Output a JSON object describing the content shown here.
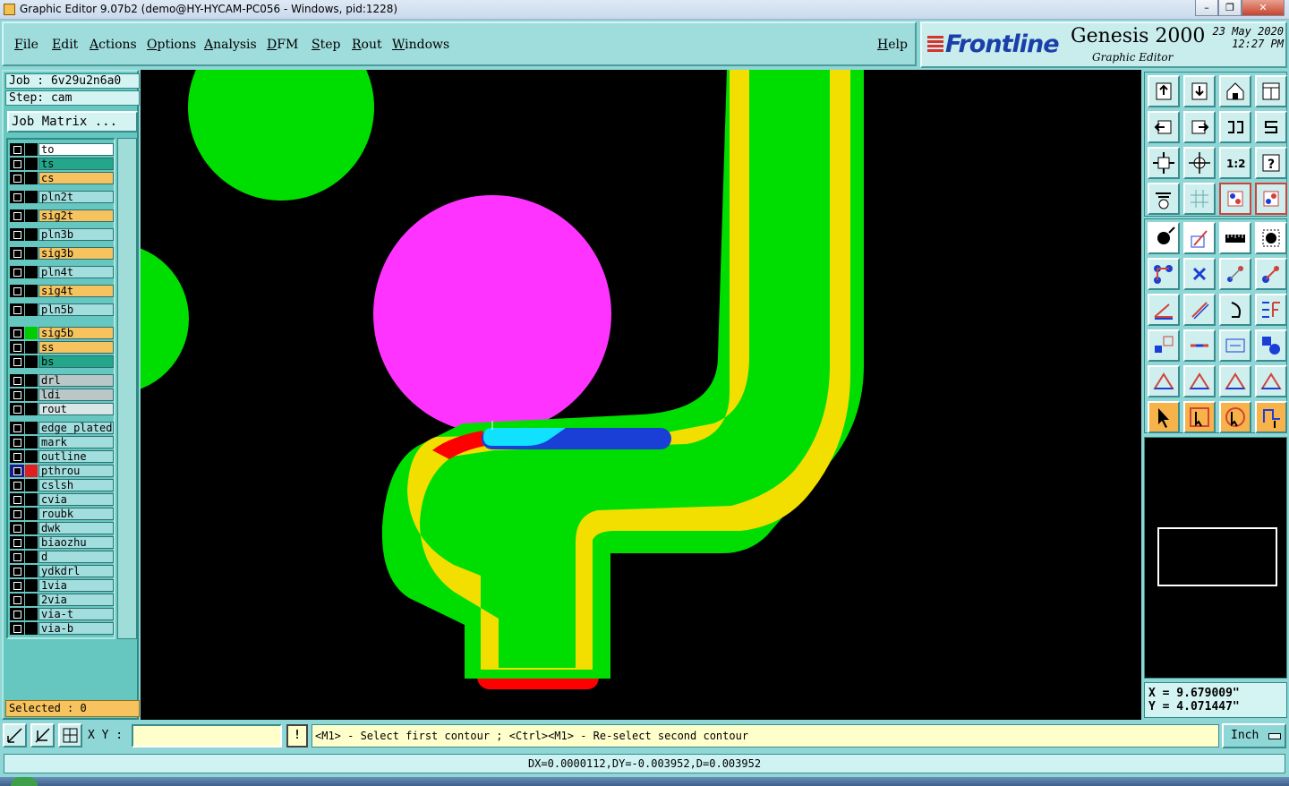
{
  "window": {
    "title": "Graphic Editor 9.07b2 (demo@HY-HYCAM-PC056 - Windows, pid:1228)",
    "controls": [
      "minimize",
      "restore",
      "close"
    ]
  },
  "menu": [
    "File",
    "Edit",
    "Actions",
    "Options",
    "Analysis",
    "DFM",
    "Step",
    "Rout",
    "Windows",
    "Help"
  ],
  "brand": {
    "logo": "Frontline",
    "product": "Genesis 2000",
    "subtitle": "Graphic Editor",
    "date": "23 May 2020",
    "time": "12:27 PM"
  },
  "job": {
    "label": "Job : 6v29u2n6a0",
    "step": "Step: cam",
    "matrix_button": "Job Matrix ..."
  },
  "layers": [
    {
      "name": "to",
      "color": "#ffffff",
      "swatch": ""
    },
    {
      "name": "ts",
      "color": "#23a68a",
      "swatch": "",
      "marker": "✎"
    },
    {
      "name": "cs",
      "color": "#f7c35f",
      "swatch": ""
    },
    {
      "name": "pln2t",
      "color": "#a3dede",
      "swatch": ""
    },
    {
      "name": "sig2t",
      "color": "#f7c35f",
      "swatch": ""
    },
    {
      "name": "pln3b",
      "color": "#a3dede",
      "swatch": ""
    },
    {
      "name": "sig3b",
      "color": "#f7c35f",
      "swatch": ""
    },
    {
      "name": "pln4t",
      "color": "#a3dede",
      "swatch": ""
    },
    {
      "name": "sig4t",
      "color": "#f7c35f",
      "swatch": ""
    },
    {
      "name": "pln5b",
      "color": "#a3dede",
      "swatch": ""
    },
    {
      "name": "sig5b",
      "color": "#f7c35f",
      "swatch": "#00cc00"
    },
    {
      "name": "ss",
      "color": "#f7c35f",
      "swatch": ""
    },
    {
      "name": "bs",
      "color": "#23a68a",
      "swatch": "",
      "marker": "✎"
    },
    {
      "name": "drl",
      "color": "#b9c7c7",
      "swatch": ""
    },
    {
      "name": "ldi",
      "color": "#b9c7c7",
      "swatch": ""
    },
    {
      "name": "rout",
      "color": "#d8e6e6",
      "swatch": ""
    },
    {
      "name": "edge_plated",
      "color": "#a3dede",
      "swatch": ""
    },
    {
      "name": "mark",
      "color": "#a3dede",
      "swatch": ""
    },
    {
      "name": "outline",
      "color": "#a3dede",
      "swatch": ""
    },
    {
      "name": "pthrou",
      "color": "#a3dede",
      "swatch": "#e02020",
      "marker": "▣",
      "affected": true
    },
    {
      "name": "cslsh",
      "color": "#a3dede",
      "swatch": ""
    },
    {
      "name": "cvia",
      "color": "#a3dede",
      "swatch": ""
    },
    {
      "name": "roubk",
      "color": "#a3dede",
      "swatch": ""
    },
    {
      "name": "dwk",
      "color": "#a3dede",
      "swatch": ""
    },
    {
      "name": "biaozhu",
      "color": "#a3dede",
      "swatch": ""
    },
    {
      "name": "d",
      "color": "#a3dede",
      "swatch": ""
    },
    {
      "name": "ydkdrl",
      "color": "#a3dede",
      "swatch": ""
    },
    {
      "name": "1via",
      "color": "#a3dede",
      "swatch": ""
    },
    {
      "name": "2via",
      "color": "#a3dede",
      "swatch": ""
    },
    {
      "name": "via-t",
      "color": "#a3dede",
      "swatch": ""
    },
    {
      "name": "via-b",
      "color": "#a3dede",
      "swatch": ""
    }
  ],
  "selected": "Selected : 0",
  "coords": {
    "x": "X = 9.679009\"",
    "y": "Y = 4.071447\""
  },
  "command": {
    "xy_label": "X Y :",
    "xy_value": "",
    "prompt": "<M1> - Select first contour ; <Ctrl><M1> - Re-select second contour",
    "units": "Inch"
  },
  "message": "DX=0.0000112,DY=-0.003952,D=0.003952",
  "colors": {
    "trace_outer": "#00dd00",
    "trace_mid": "#f2df00",
    "pad_magenta": "#ff33ff",
    "highlight_red": "#ff0000",
    "segment_blue": "#1a3fd6",
    "segment_cyan": "#11e0ff"
  }
}
